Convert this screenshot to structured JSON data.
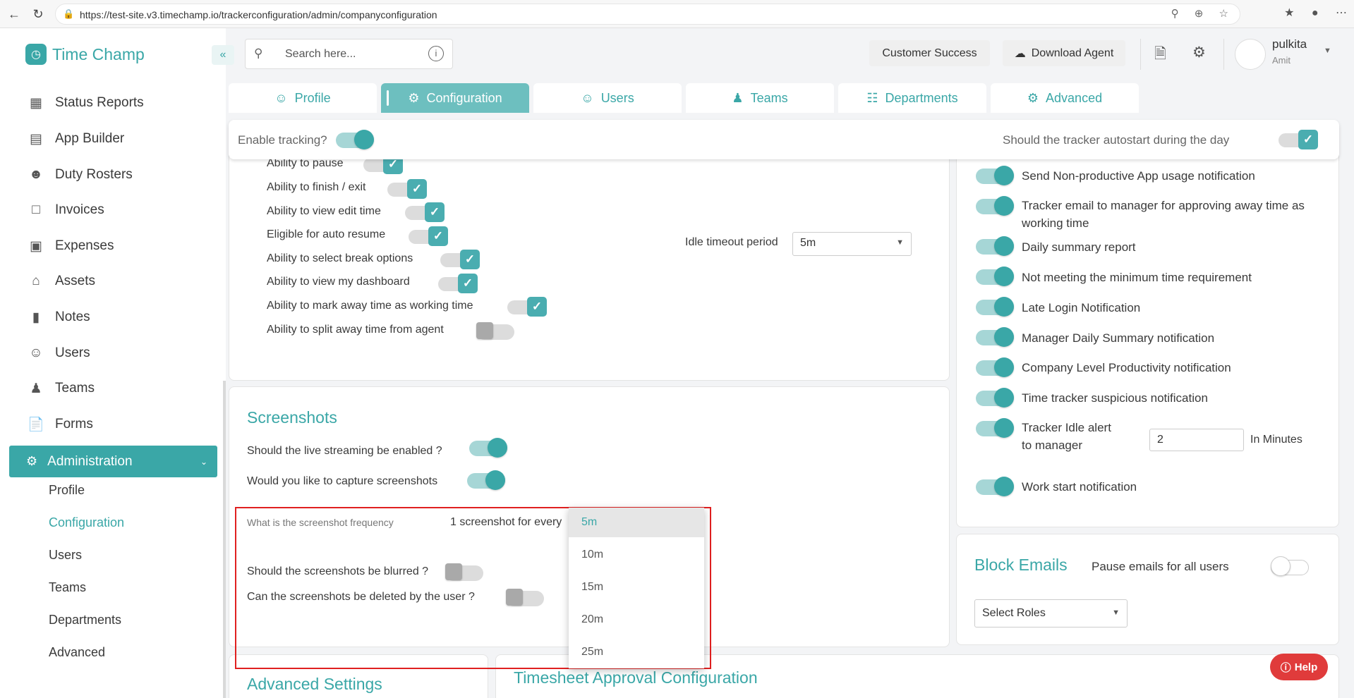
{
  "browser": {
    "url": "https://test-site.v3.timechamp.io/trackerconfiguration/admin/companyconfiguration"
  },
  "app": {
    "name": "Time Champ"
  },
  "sidebar": {
    "items": [
      {
        "label": "Status Reports",
        "icon": "dashboard-icon"
      },
      {
        "label": "App Builder",
        "icon": "app-builder-icon"
      },
      {
        "label": "Duty Rosters",
        "icon": "user-plus-icon"
      },
      {
        "label": "Invoices",
        "icon": "invoice-icon"
      },
      {
        "label": "Expenses",
        "icon": "wallet-icon"
      },
      {
        "label": "Assets",
        "icon": "bank-icon"
      },
      {
        "label": "Notes",
        "icon": "book-icon"
      },
      {
        "label": "Users",
        "icon": "user-icon"
      },
      {
        "label": "Teams",
        "icon": "teams-icon"
      },
      {
        "label": "Forms",
        "icon": "form-icon"
      }
    ],
    "admin": {
      "label": "Administration"
    },
    "sub_items": [
      "Profile",
      "Configuration",
      "Users",
      "Teams",
      "Departments",
      "Advanced"
    ]
  },
  "header": {
    "search_placeholder": "Search here...",
    "customer_success": "Customer Success",
    "download_agent": "Download Agent",
    "user_name": "pulkita",
    "user_sub": "Amit"
  },
  "tabs": [
    "Profile",
    "Configuration",
    "Users",
    "Teams",
    "Departments",
    "Advanced"
  ],
  "tracking": {
    "enable_label": "Enable tracking?",
    "autostart_label": "Should the tracker autostart during the day"
  },
  "abilities": {
    "partial": "Ability to pause",
    "rows": [
      {
        "label": "Ability to finish / exit",
        "checked": true
      },
      {
        "label": "Ability to view edit time",
        "checked": true
      },
      {
        "label": "Eligible for auto resume",
        "checked": true
      },
      {
        "label": "Ability to select break options",
        "checked": true
      },
      {
        "label": "Ability to view my dashboard",
        "checked": true
      },
      {
        "label": "Ability to mark away time as working time",
        "checked": true
      },
      {
        "label": "Ability to split away time from agent",
        "checked": false
      }
    ],
    "idle_label": "Idle timeout period",
    "idle_value": "5m"
  },
  "notifications": {
    "items": [
      "Send Non-productive App usage notification",
      "Tracker email to manager for approving away time as working time",
      "Daily summary report",
      "Not meeting the minimum time requirement",
      "Late Login Notification",
      "Manager Daily Summary notification",
      "Company Level Productivity notification",
      "Time tracker suspicious notification",
      "Tracker Idle alert to manager",
      "Work start notification"
    ],
    "idle_alert_value": "2",
    "idle_alert_unit": "In Minutes"
  },
  "screenshots": {
    "title": "Screenshots",
    "live_streaming": "Should the live streaming be enabled ?",
    "capture": "Would you like to capture screenshots",
    "frequency_label": "What is the screenshot frequency",
    "frequency_prefix": "1 screenshot for every",
    "blurred": "Should the screenshots be blurred ?",
    "deleted": "Can the screenshots be deleted by the user ?",
    "options": [
      "5m",
      "10m",
      "15m",
      "20m",
      "25m"
    ],
    "selected": "5m"
  },
  "block_emails": {
    "title": "Block Emails",
    "pause_label": "Pause emails for all users",
    "select_roles": "Select Roles"
  },
  "bottom": {
    "advanced_settings": "Advanced Settings",
    "timesheet": "Timesheet Approval Configuration"
  },
  "help": "Help",
  "colors": {
    "accent": "#3aa7a7",
    "help": "#e03b3b",
    "highlight": "#e02020"
  }
}
